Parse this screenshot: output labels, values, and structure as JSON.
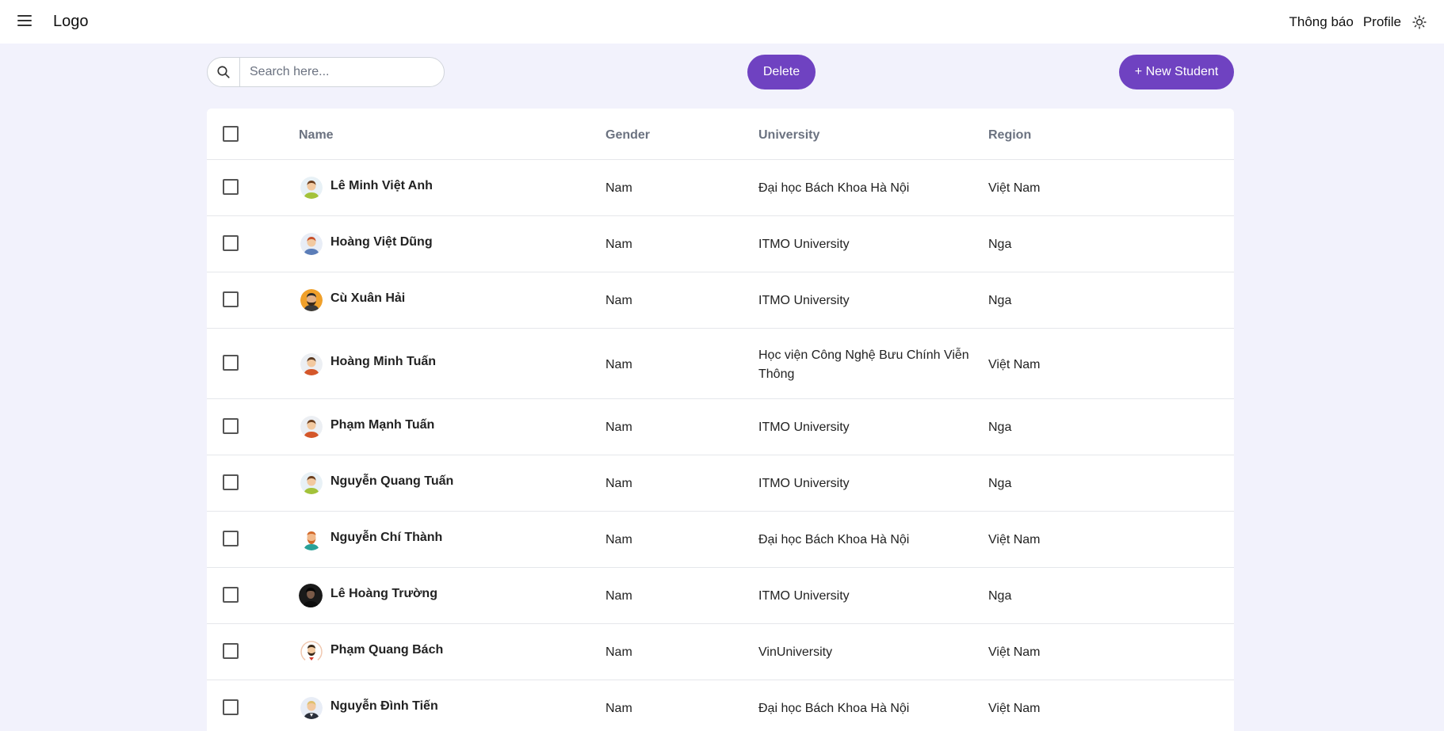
{
  "nav": {
    "logo": "Logo",
    "notifications": "Thông báo",
    "profile": "Profile"
  },
  "toolbar": {
    "search_placeholder": "Search here...",
    "delete_label": "Delete",
    "new_label": "+ New Student"
  },
  "table": {
    "headers": {
      "name": "Name",
      "gender": "Gender",
      "university": "University",
      "region": "Region"
    },
    "rows": [
      {
        "name": "Lê Minh Việt Anh",
        "gender": "Nam",
        "university": "Đại học Bách Khoa Hà Nội",
        "region": "Việt Nam"
      },
      {
        "name": "Hoàng Việt Dũng",
        "gender": "Nam",
        "university": "ITMO University",
        "region": "Nga"
      },
      {
        "name": "Cù Xuân Hải",
        "gender": "Nam",
        "university": "ITMO University",
        "region": "Nga"
      },
      {
        "name": "Hoàng Minh Tuấn",
        "gender": "Nam",
        "university": "Học viện Công Nghệ Bưu Chính Viễn Thông",
        "region": "Việt Nam"
      },
      {
        "name": "Phạm Mạnh Tuấn",
        "gender": "Nam",
        "university": "ITMO University",
        "region": "Nga"
      },
      {
        "name": "Nguyễn Quang Tuấn",
        "gender": "Nam",
        "university": "ITMO University",
        "region": "Nga"
      },
      {
        "name": "Nguyễn Chí Thành",
        "gender": "Nam",
        "university": "Đại học Bách Khoa Hà Nội",
        "region": "Việt Nam"
      },
      {
        "name": "Lê Hoàng Trường",
        "gender": "Nam",
        "university": "ITMO University",
        "region": "Nga"
      },
      {
        "name": "Phạm Quang Bách",
        "gender": "Nam",
        "university": "VinUniversity",
        "region": "Việt Nam"
      },
      {
        "name": "Nguyễn Đình Tiến",
        "gender": "Nam",
        "university": "Đại học Bách Khoa Hà Nội",
        "region": "Việt Nam"
      }
    ]
  },
  "colors": {
    "accent": "#6f42c1",
    "background": "#f2f2fc"
  }
}
